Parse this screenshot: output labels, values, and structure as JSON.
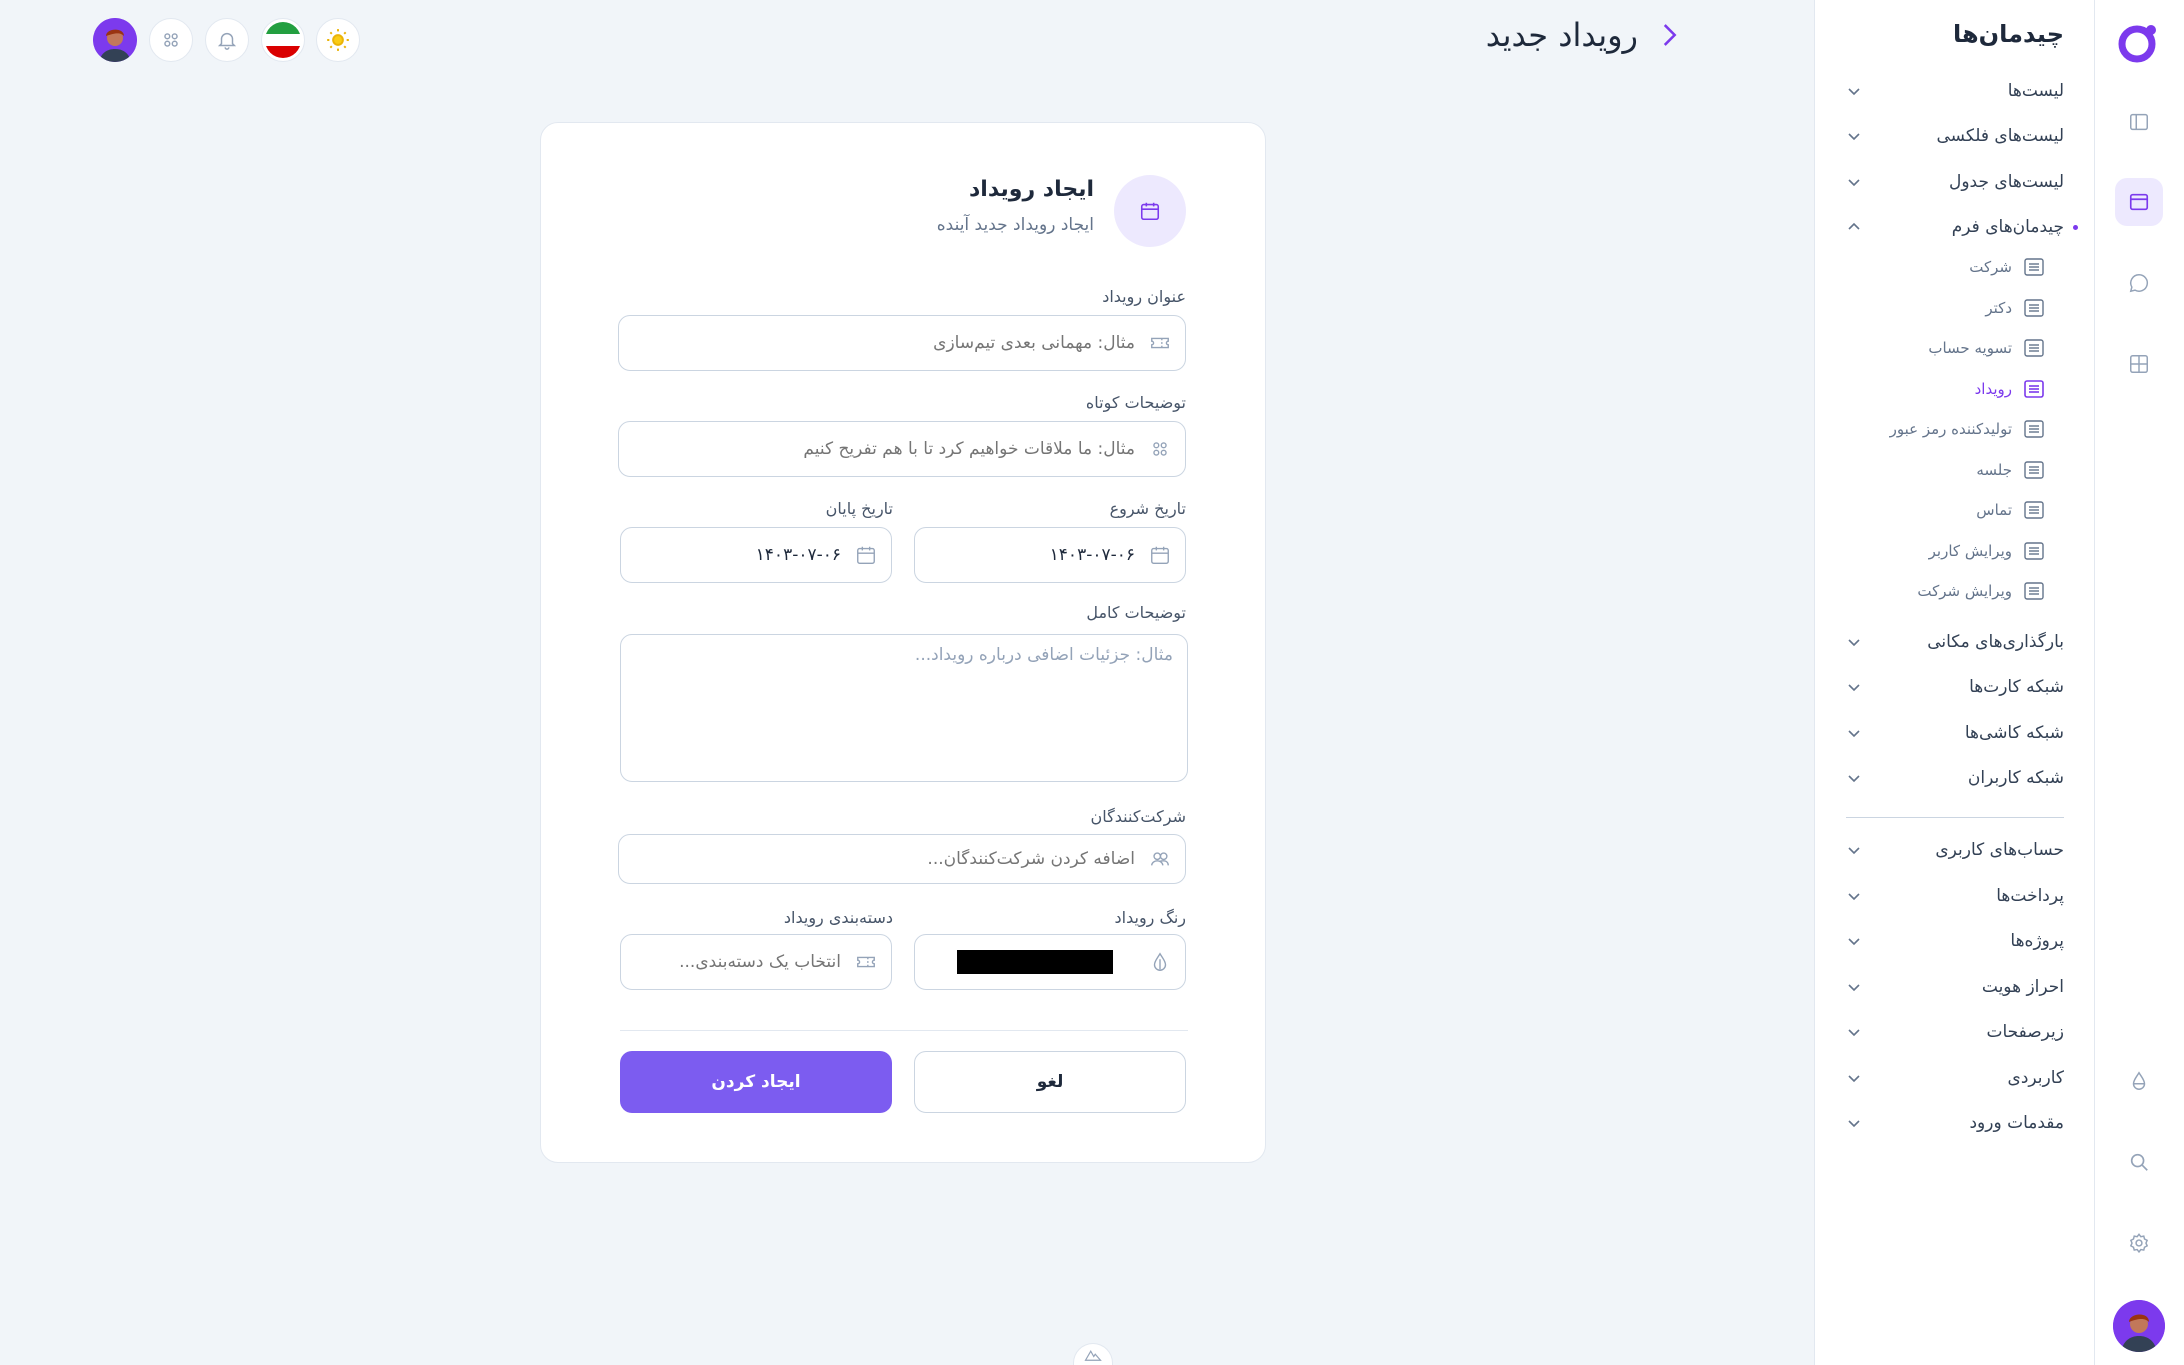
{
  "header": {
    "title": "رویداد جدید"
  },
  "sidebar": {
    "title": "چیدمان‌ها",
    "groups": [
      {
        "label": "لیست‌ها"
      },
      {
        "label": "لیست‌های فلکسی"
      },
      {
        "label": "لیست‌های جدول"
      },
      {
        "label": "چیدمان‌های فرم"
      }
    ],
    "form_items": [
      {
        "label": "شرکت"
      },
      {
        "label": "دکتر"
      },
      {
        "label": "تسویه حساب"
      },
      {
        "label": "رویداد"
      },
      {
        "label": "تولیدکننده رمز عبور"
      },
      {
        "label": "جلسه"
      },
      {
        "label": "تماس"
      },
      {
        "label": "ویرایش کاربر"
      },
      {
        "label": "ویرایش شرکت"
      }
    ],
    "groups2": [
      {
        "label": "بارگذاری‌های مکانی"
      },
      {
        "label": "شبکه کارت‌ها"
      },
      {
        "label": "شبکه کاشی‌ها"
      },
      {
        "label": "شبکه کاربران"
      }
    ],
    "groups3": [
      {
        "label": "حساب‌های کاربری"
      },
      {
        "label": "پرداخت‌ها"
      },
      {
        "label": "پروژه‌ها"
      },
      {
        "label": "احراز هویت"
      },
      {
        "label": "زیرصفحات"
      },
      {
        "label": "کاربردی"
      },
      {
        "label": "مقدمات ورود"
      }
    ]
  },
  "form": {
    "title": "ایجاد رویداد",
    "subtitle": "ایجاد رویداد جدید آینده",
    "event_title": {
      "label": "عنوان رویداد",
      "placeholder": "مثال: مهمانی بعدی تیم‌سازی"
    },
    "short_desc": {
      "label": "توضیحات کوتاه",
      "placeholder": "مثال: ما ملاقات خواهیم کرد تا با هم تفریح کنیم"
    },
    "start_date": {
      "label": "تاریخ شروع",
      "value": "۱۴۰۳-۰۷-۰۶"
    },
    "end_date": {
      "label": "تاریخ پایان",
      "value": "۱۴۰۳-۰۷-۰۶"
    },
    "full_desc": {
      "label": "توضیحات کامل",
      "placeholder": "مثال: جزئیات اضافی درباره رویداد..."
    },
    "participants": {
      "label": "شرکت‌کنندگان",
      "placeholder": "اضافه کردن شرکت‌کنندگان..."
    },
    "color": {
      "label": "رنگ رویداد",
      "value": "#000000"
    },
    "category": {
      "label": "دسته‌بندی رویداد",
      "placeholder": "انتخاب یک دسته‌بندی..."
    },
    "cancel_label": "لغو",
    "submit_label": "ایجاد کردن"
  },
  "colors": {
    "accent": "#7c5cf0",
    "accent_soft": "#ede9fe",
    "background": "#f1f5f9"
  }
}
